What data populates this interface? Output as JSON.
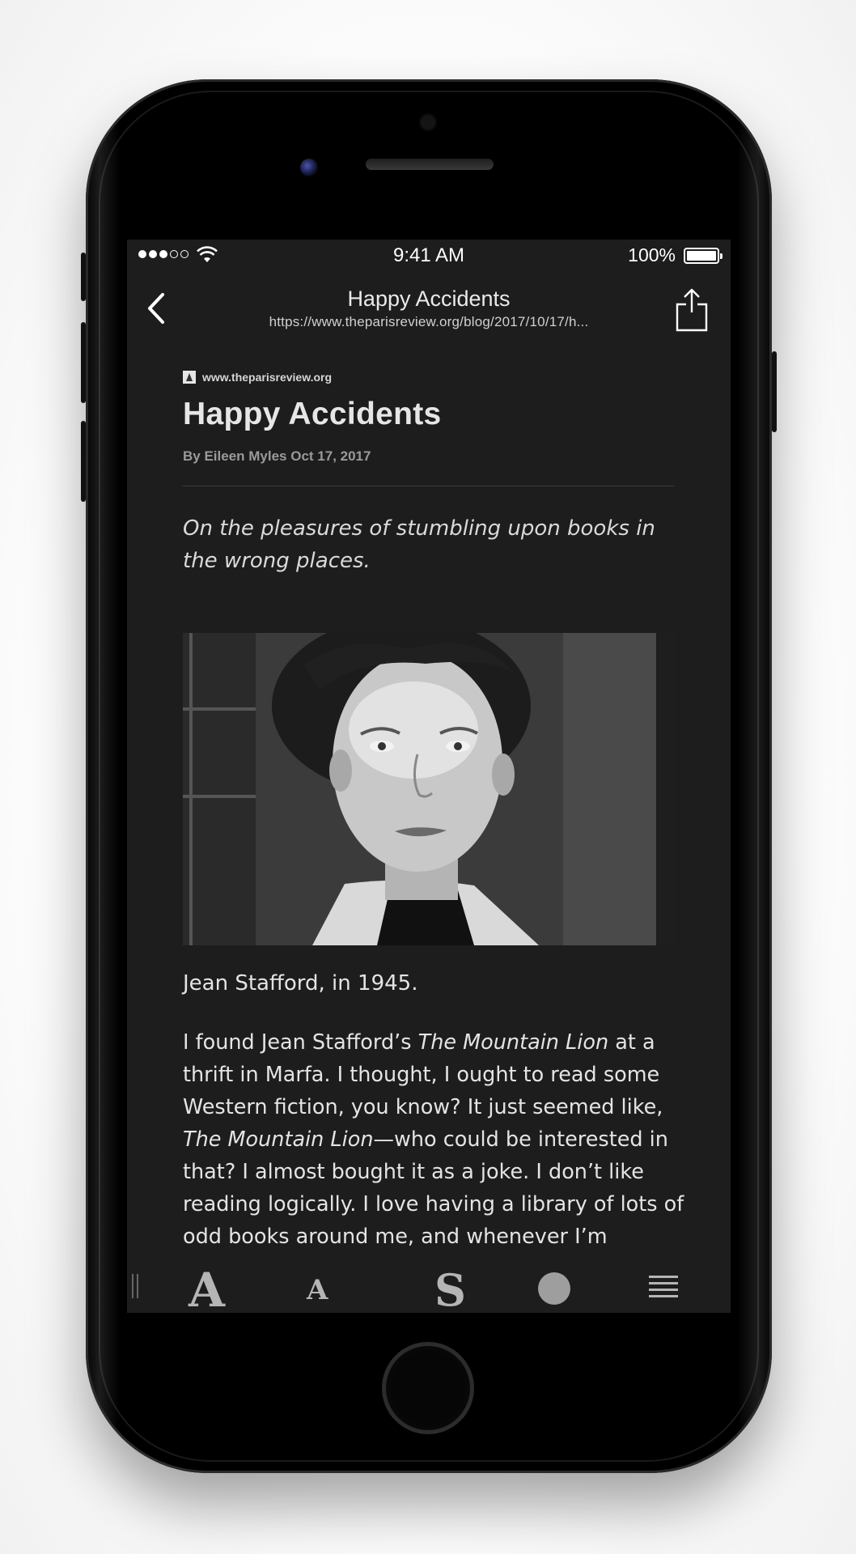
{
  "status_bar": {
    "time": "9:41 AM",
    "battery": "100%",
    "signal_bars": 3,
    "signal_total": 5
  },
  "nav": {
    "title": "Happy Accidents",
    "url": "https://www.theparisreview.org/blog/2017/10/17/h..."
  },
  "article": {
    "source": "www.theparisreview.org",
    "headline": "Happy Accidents",
    "byline": "By Eileen Myles Oct 17, 2017",
    "dek": "On the pleasures of stumbling upon books in the wrong places.",
    "caption": "Jean Stafford, in 1945.",
    "body": {
      "p1": "I found Jean Stafford’s ",
      "p2": "The Mountain Lion",
      "p3": " at a thrift in Marfa. I thought, I ought to read some Western fiction, you know? It just seemed like, ",
      "p4": "The Mountain Lion",
      "p5": "—who could be interested in that? I almost bought it as a joke. I don’t like reading logically. I love having a library of lots of odd books around me, and whenever I’m"
    }
  },
  "toolbar": {
    "increase_font": "A",
    "decrease_font": "A",
    "serif_font": "S"
  },
  "icons": {
    "back": "chevron-left-icon",
    "share": "share-icon",
    "wifi": "wifi-icon",
    "battery": "battery-icon",
    "theme": "circle-icon",
    "justify": "justify-lines-icon"
  }
}
